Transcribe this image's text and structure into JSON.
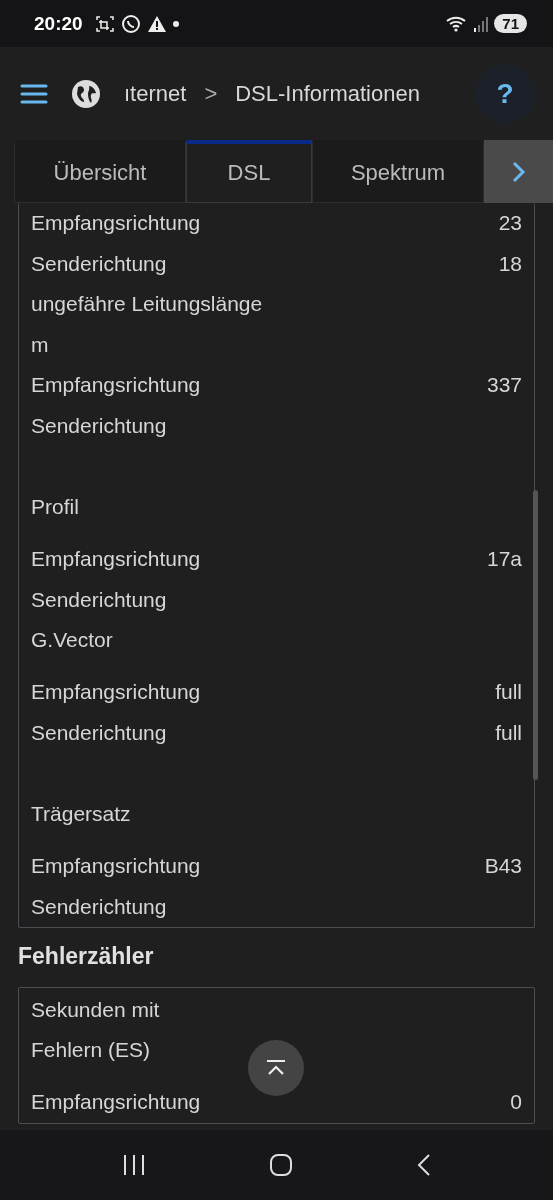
{
  "status_bar": {
    "time": "20:20",
    "battery": "71"
  },
  "header": {
    "breadcrumb": [
      {
        "label": "ıternet"
      },
      {
        "label": "DSL-Informationen"
      }
    ],
    "separator": ">",
    "help": "?"
  },
  "tabs": [
    {
      "label": "Übersicht",
      "selected": false
    },
    {
      "label": "DSL",
      "selected": true
    },
    {
      "label": "Spektrum",
      "selected": false
    }
  ],
  "cards": [
    {
      "rows": [
        {
          "kind": "row",
          "label": "Empfangsrichtung",
          "value": "23"
        },
        {
          "kind": "row",
          "label": "Senderichtung",
          "value": "18"
        },
        {
          "kind": "row",
          "label": "ungefähre Leitungslänge"
        },
        {
          "kind": "row",
          "label": "m"
        },
        {
          "kind": "row",
          "label": "Empfangsrichtung",
          "value": "337"
        },
        {
          "kind": "row",
          "label": "Senderichtung"
        },
        {
          "kind": "spacer"
        },
        {
          "kind": "title",
          "label": "Profil"
        },
        {
          "kind": "row",
          "label": "Empfangsrichtung",
          "value": "17a"
        },
        {
          "kind": "row",
          "label": "Senderichtung"
        },
        {
          "kind": "title",
          "label": "G.Vector"
        },
        {
          "kind": "row",
          "label": "Empfangsrichtung",
          "value": "full"
        },
        {
          "kind": "row",
          "label": "Senderichtung",
          "value": "full"
        },
        {
          "kind": "spacer"
        },
        {
          "kind": "title",
          "label": "Trägersatz"
        },
        {
          "kind": "row",
          "label": "Empfangsrichtung",
          "value": "B43"
        },
        {
          "kind": "row",
          "label": "Senderichtung"
        }
      ]
    },
    {
      "heading": "Fehlerzähler",
      "rows": [
        {
          "kind": "narrow",
          "label": "Sekunden mit Fehlern (ES)"
        },
        {
          "kind": "row",
          "label": "Empfangsrichtung",
          "value": "0"
        }
      ]
    }
  ]
}
